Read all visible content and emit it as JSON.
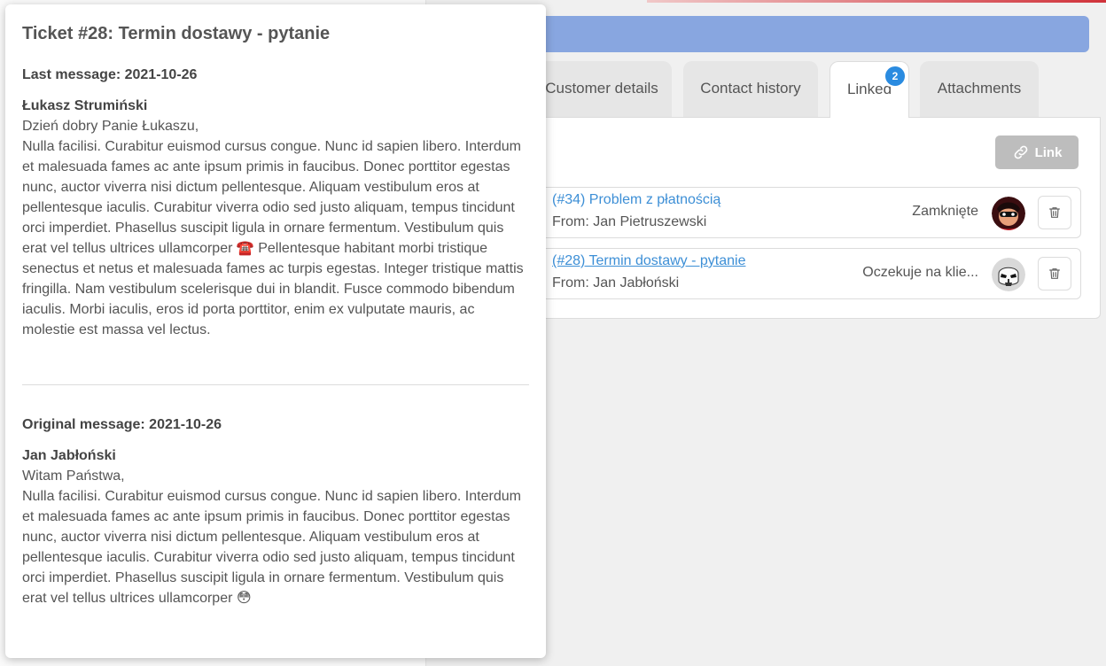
{
  "tabs": [
    {
      "label": "Customer details",
      "active": false
    },
    {
      "label": "Contact history",
      "active": false
    },
    {
      "label": "Linked",
      "active": true,
      "badge": "2"
    },
    {
      "label": "Attachments",
      "active": false
    }
  ],
  "panel": {
    "link_button_label": "Link",
    "linked_tickets": [
      {
        "title": "(#34) Problem z płatnością",
        "from": "From: Jan Pietruszewski",
        "status": "Zamknięte",
        "avatar_icon": "superhero-avatar-icon",
        "delete_icon": "trash-icon"
      },
      {
        "title": "(#28) Termin dostawy - pytanie",
        "from": "From: Jan Jabłoński",
        "status": "Oczekuje na klie...",
        "avatar_icon": "stormtrooper-avatar-icon",
        "delete_icon": "trash-icon"
      }
    ]
  },
  "popover": {
    "title": "Ticket #28: Termin dostawy - pytanie",
    "last_message": {
      "heading": "Last message: 2021-10-26",
      "author": "Łukasz Strumiński",
      "greeting": "Dzień dobry Panie Łukaszu,",
      "body": "Nulla facilisi. Curabitur euismod cursus congue. Nunc id sapien libero. Interdum et malesuada fames ac ante ipsum primis in faucibus. Donec porttitor egestas nunc, auctor viverra nisi dictum pellentesque. Aliquam vestibulum eros at pellentesque iaculis. Curabitur viverra odio sed justo aliquam, tempus tincidunt orci imperdiet. Phasellus suscipit ligula in ornare fermentum. Vestibulum quis erat vel tellus ultrices ullamcorper ☎️ Pellentesque habitant morbi tristique senectus et netus et malesuada fames ac turpis egestas. Integer tristique mattis fringilla. Nam vestibulum scelerisque dui in blandit. Fusce commodo bibendum iaculis. Morbi iaculis, eros id porta porttitor, enim ex vulputate mauris, ac molestie est massa vel lectus."
    },
    "original_message": {
      "heading": "Original message: 2021-10-26",
      "author": "Jan Jabłoński",
      "greeting": "Witam Państwa,",
      "body": "Nulla facilisi. Curabitur euismod cursus congue. Nunc id sapien libero. Interdum et malesuada fames ac ante ipsum primis in faucibus. Donec porttitor egestas nunc, auctor viverra nisi dictum pellentesque. Aliquam vestibulum eros at pellentesque iaculis. Curabitur viverra odio sed justo aliquam, tempus tincidunt orci imperdiet. Phasellus suscipit ligula in ornare fermentum. Vestibulum quis erat vel tellus ultrices ullamcorper 😳"
    }
  },
  "colors": {
    "accent_blue": "#88a6e0",
    "link_blue": "#3d8fd6",
    "badge_blue": "#2a8be0",
    "button_disabled": "#bdbdbd"
  }
}
